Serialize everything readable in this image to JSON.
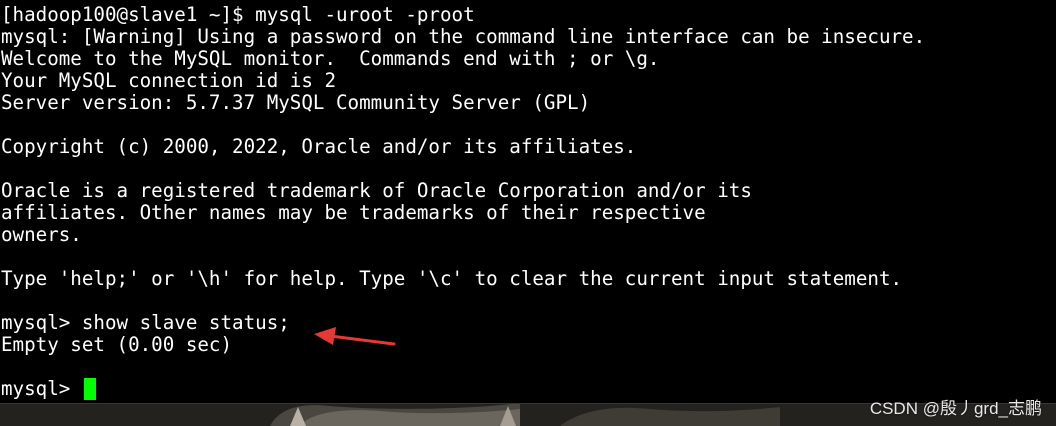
{
  "terminal": {
    "lines": [
      "[hadoop100@slave1 ~]$ mysql -uroot -proot",
      "mysql: [Warning] Using a password on the command line interface can be insecure.",
      "Welcome to the MySQL monitor.  Commands end with ; or \\g.",
      "Your MySQL connection id is 2",
      "Server version: 5.7.37 MySQL Community Server (GPL)",
      "",
      "Copyright (c) 2000, 2022, Oracle and/or its affiliates.",
      "",
      "Oracle is a registered trademark of Oracle Corporation and/or its",
      "affiliates. Other names may be trademarks of their respective",
      "owners.",
      "",
      "Type 'help;' or '\\h' for help. Type '\\c' to clear the current input statement.",
      "",
      "mysql> show slave status;",
      "Empty set (0.00 sec)",
      "",
      "mysql> "
    ],
    "cursor_color": "#00ff00",
    "text_color": "#ffffff",
    "background_color": "#000000"
  },
  "annotation": {
    "arrow_color": "#e53935",
    "icon": "red-arrow-icon"
  },
  "watermark": {
    "text": "CSDN @殷丿grd_志鹏"
  }
}
